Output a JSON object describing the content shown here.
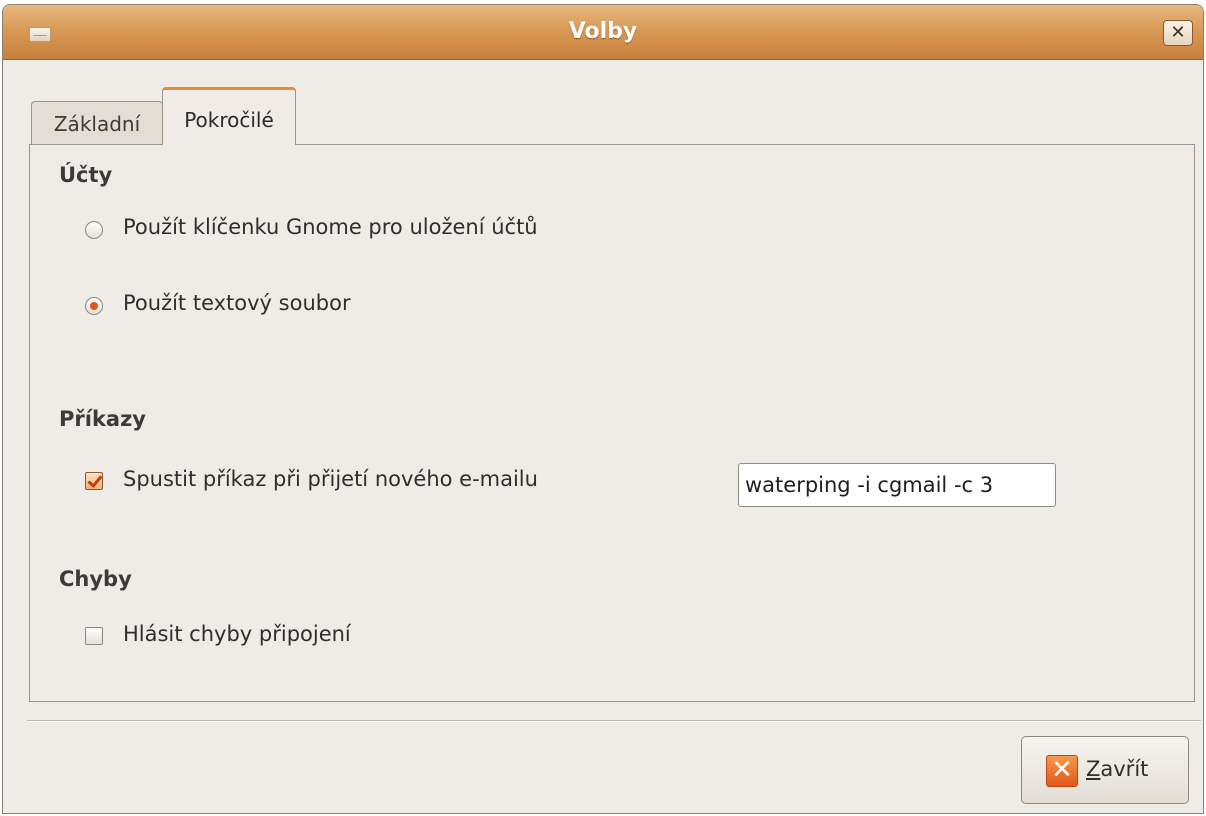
{
  "window": {
    "title": "Volby",
    "close_glyph": "✕",
    "icon": "window-mail-icon"
  },
  "tabs": [
    {
      "label": "Základní",
      "active": false
    },
    {
      "label": "Pokročilé",
      "active": true
    }
  ],
  "sections": {
    "accounts": {
      "heading": "Účty",
      "options": [
        {
          "label": "Použít klíčenku Gnome pro uložení účtů",
          "checked": false
        },
        {
          "label": "Použít textový soubor",
          "checked": true
        }
      ]
    },
    "commands": {
      "heading": "Příkazy",
      "run_command": {
        "label": "Spustit příkaz při přijetí nového e-mailu",
        "checked": true
      },
      "command_value": "waterping -i cgmail -c 3"
    },
    "errors": {
      "heading": "Chyby",
      "report_errors": {
        "label": "Hlásit chyby připojení",
        "checked": false
      }
    }
  },
  "footer": {
    "close_button": {
      "mnemonic": "Z",
      "rest": "avřít",
      "icon": "close-x-icon"
    }
  },
  "colors": {
    "titlebar": "#d99a57",
    "accent": "#e2581c",
    "background": "#efebe7"
  }
}
